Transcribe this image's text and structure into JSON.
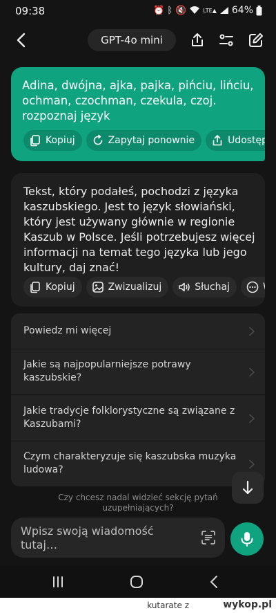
{
  "status_bar": {
    "time": "09:38",
    "battery": "64%",
    "icons": [
      "alarm-icon",
      "bluetooth-icon",
      "mute-icon",
      "wifi-icon",
      "lte-signal-icon",
      "battery-icon"
    ]
  },
  "header": {
    "model_label": "GPT-4o mini",
    "icons": [
      "back-arrow-icon",
      "share-icon",
      "sliders-icon",
      "edit-icon"
    ]
  },
  "user_message": {
    "text": "Adina, dwójna, ajka, pajka, pińciu, lińciu, ochman, czochman, czekula, czoj. rozpoznaj język",
    "actions": [
      {
        "label": "Kopiuj",
        "icon": "copy-icon"
      },
      {
        "label": "Zapytaj ponownie",
        "icon": "refresh-icon"
      },
      {
        "label": "Udostępnij",
        "icon": "share-icon"
      }
    ]
  },
  "assistant_message": {
    "text": "Tekst, który podałeś, pochodzi z języka kaszubskiego. Jest to język słowiański, który jest używany głównie w regionie Kaszub w Polsce. Jeśli potrzebujesz więcej informacji na temat tego języka lub jego kultury, daj znać!",
    "actions": [
      {
        "label": "Kopiuj",
        "icon": "copy-icon"
      },
      {
        "label": "Zwizualizuj",
        "icon": "image-icon"
      },
      {
        "label": "Słuchaj",
        "icon": "speaker-icon"
      },
      {
        "label": "W",
        "icon": "more-icon"
      }
    ]
  },
  "suggestions": [
    {
      "text": "Powiedz mi więcej"
    },
    {
      "text": "Jakie są najpopularniejsze potrawy kaszubskie?"
    },
    {
      "text": "Jakie tradycje folklorystyczne są związane z Kaszubami?"
    },
    {
      "text": "Czym charakteryzuje się kaszubska muzyka ludowa?"
    }
  ],
  "suggestions_note": "Czy chcesz nadal widzieć sekcję pytań uzupełniających?",
  "composer": {
    "placeholder": "Wpisz swoją wiadomość tutaj…",
    "icons": [
      "scan-text-icon",
      "microphone-icon"
    ]
  },
  "nav_bar": {
    "icons": [
      "recents-icon",
      "home-icon",
      "back-icon"
    ]
  },
  "watermark": {
    "user": "kutarate",
    "conj": "z",
    "site": "wykop.pl"
  },
  "colors": {
    "accent": "#10a37f",
    "background": "#141414",
    "assistant_bubble": "#1f1f1f",
    "suggestions_bg": "#232323"
  }
}
